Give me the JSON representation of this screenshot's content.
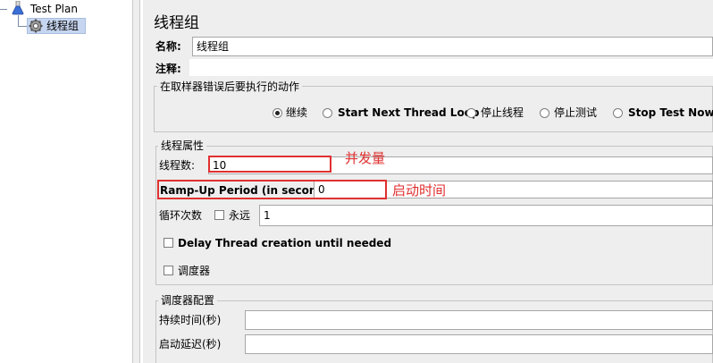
{
  "tree": {
    "test_plan": "Test Plan",
    "thread_group": "线程组"
  },
  "panel": {
    "title": "线程组",
    "name_label": "名称:",
    "name_value": "线程组",
    "comment_label": "注释:",
    "comment_value": ""
  },
  "error_action": {
    "title": "在取样器错误后要执行的动作",
    "options": [
      "继续",
      "Start Next Thread Loop",
      "停止线程",
      "停止测试",
      "Stop Test Now"
    ],
    "selected": "继续"
  },
  "thread_props": {
    "title": "线程属性",
    "threads_label": "线程数:",
    "threads_value": "10",
    "rampup_label": "Ramp-Up Period (in seconds):",
    "rampup_value": "0",
    "loop_label": "循环次数",
    "forever_label": "永远",
    "forever_checked": false,
    "loop_value": "1",
    "delay_label": "Delay Thread creation until needed",
    "delay_checked": false,
    "scheduler_label": "调度器",
    "scheduler_checked": false
  },
  "scheduler_config": {
    "title": "调度器配置",
    "duration_label": "持续时间(秒)",
    "duration_value": "",
    "delay_label": "启动延迟(秒)",
    "delay_value": ""
  },
  "annotations": {
    "threads_note": "并发量",
    "rampup_note": "启动时间",
    "color": "#e03030"
  }
}
